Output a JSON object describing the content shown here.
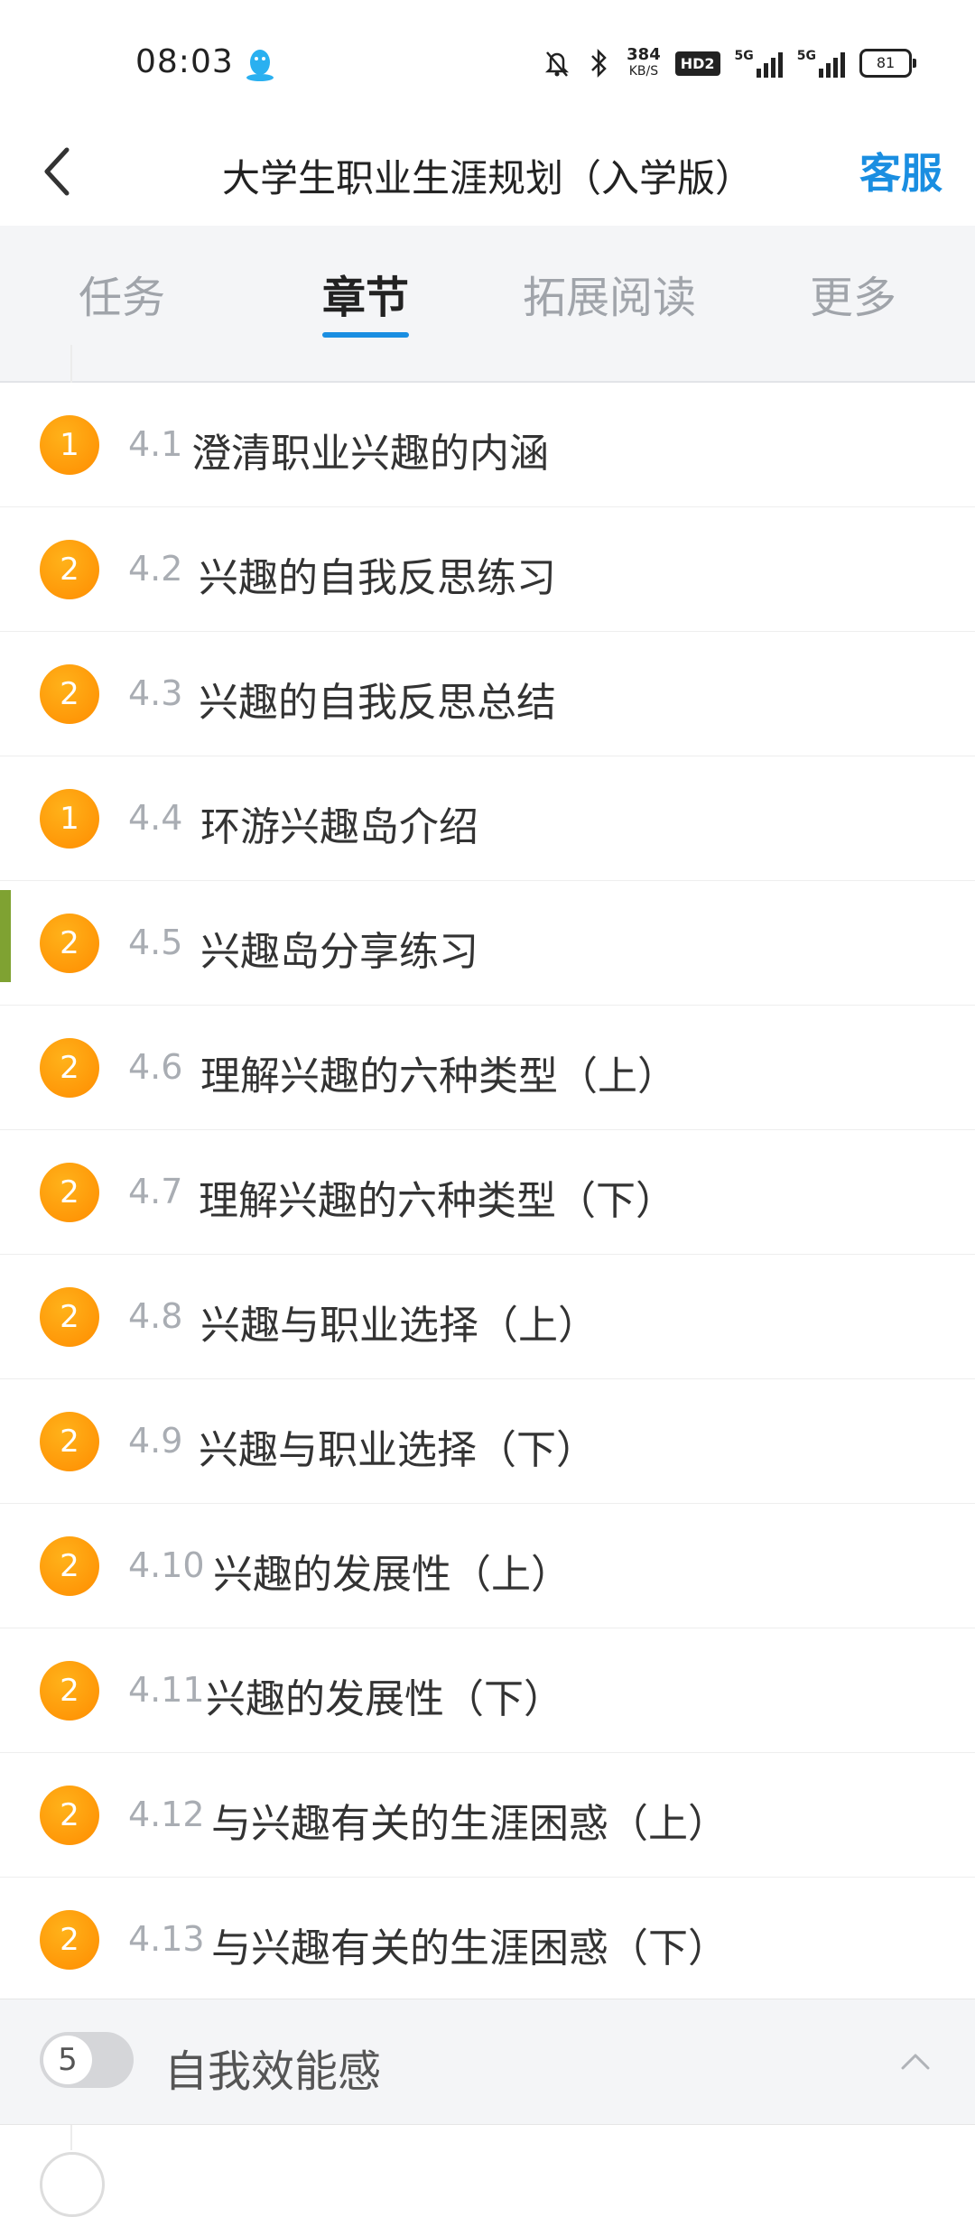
{
  "status": {
    "time": "08:03",
    "speed_value": "384",
    "speed_unit": "KB/S",
    "hd_label": "HD2",
    "sim1": "5G",
    "sim2": "5G",
    "battery": "81"
  },
  "header": {
    "title": "大学生职业生涯规划（入学版）",
    "service_label": "客服"
  },
  "tabs": [
    {
      "label": "任务"
    },
    {
      "label": "章节"
    },
    {
      "label": "拓展阅读"
    },
    {
      "label": "更多"
    }
  ],
  "lessons": [
    {
      "badge": "1",
      "num": "4.1",
      "title": "澄清职业兴趣的内涵"
    },
    {
      "badge": "2",
      "num": "4.2",
      "title": "兴趣的自我反思练习"
    },
    {
      "badge": "2",
      "num": "4.3",
      "title": "兴趣的自我反思总结"
    },
    {
      "badge": "1",
      "num": "4.4",
      "title": "环游兴趣岛介绍"
    },
    {
      "badge": "2",
      "num": "4.5",
      "title": "兴趣岛分享练习"
    },
    {
      "badge": "2",
      "num": "4.6",
      "title": "理解兴趣的六种类型（上）"
    },
    {
      "badge": "2",
      "num": "4.7",
      "title": "理解兴趣的六种类型（下）"
    },
    {
      "badge": "2",
      "num": "4.8",
      "title": "兴趣与职业选择（上）"
    },
    {
      "badge": "2",
      "num": "4.9",
      "title": "兴趣与职业选择（下）"
    },
    {
      "badge": "2",
      "num": "4.10",
      "title": "兴趣的发展性（上）"
    },
    {
      "badge": "2",
      "num": "4.11",
      "title": "兴趣的发展性（下）"
    },
    {
      "badge": "2",
      "num": "4.12",
      "title": "与兴趣有关的生涯困惑（上）"
    },
    {
      "badge": "2",
      "num": "4.13",
      "title": "与兴趣有关的生涯困惑（下）"
    }
  ],
  "section": {
    "number": "5",
    "title": "自我效能感"
  },
  "colors": {
    "accent": "#1a8ee1",
    "badge": "#ff9a00",
    "current_marker": "#7fa232"
  }
}
